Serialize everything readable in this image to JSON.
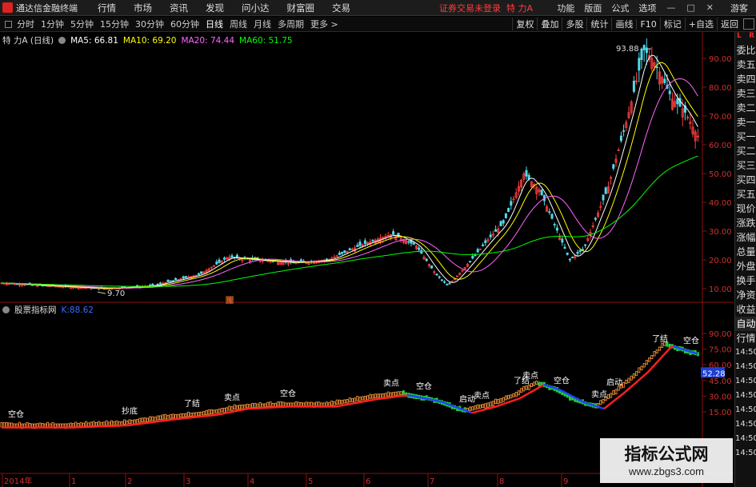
{
  "app": {
    "title": "通达信金融终端",
    "trade_status": "证券交易未登录",
    "stock_name": "特 力A",
    "guest": "游客"
  },
  "menu": [
    "行情",
    "市场",
    "资讯",
    "发现",
    "问小达",
    "财富圈",
    "交易"
  ],
  "right_menu": [
    "功能",
    "版面",
    "公式",
    "选项"
  ],
  "window_buttons": [
    "—",
    "□",
    "✕"
  ],
  "periods": [
    "分时",
    "1分钟",
    "5分钟",
    "15分钟",
    "30分钟",
    "60分钟",
    "日线",
    "周线",
    "月线",
    "多周期",
    "更多 >"
  ],
  "active_period": "日线",
  "tool_buttons": [
    "复权",
    "叠加",
    "多股",
    "统计",
    "画线",
    "F10",
    "标记",
    "+自选",
    "返回"
  ],
  "info_line": {
    "title": "特 力A (日线)",
    "ma5": "MA5: 66.81",
    "ma10": "MA10: 69.20",
    "ma20": "MA20: 74.44",
    "ma60": "MA60: 51.75",
    "colors": {
      "ma5": "#ffffff",
      "ma10": "#ffff00",
      "ma20": "#ff66ff",
      "ma60": "#00ff00"
    }
  },
  "indicator_line": {
    "title": "股票指标网",
    "value": "K:88.62"
  },
  "price_axis": [
    "90.00",
    "80.00",
    "70.00",
    "60.00",
    "50.00",
    "40.00",
    "30.00",
    "20.00",
    "10.00"
  ],
  "indicator_axis": [
    "90.00",
    "75.00",
    "60.00",
    "45.00",
    "30.00",
    "15.00"
  ],
  "current_indicator_value": "52.28",
  "time_axis": [
    "2014年",
    "1",
    "2",
    "3",
    "4",
    "5",
    "6",
    "7",
    "8",
    "9"
  ],
  "annotations": {
    "high": "93.88",
    "low": "9.70",
    "candle_flag": "库"
  },
  "signals": [
    "空仓",
    "抄底",
    "卖点",
    "了结",
    "卖点",
    "空仓",
    "卖点",
    "空仓",
    "启动",
    "卖点",
    "了结",
    "卖点",
    "空仓",
    "启动",
    "了结",
    "空仓"
  ],
  "side_tabs": [
    "委比",
    "卖五",
    "卖四",
    "卖三",
    "卖二",
    "卖一",
    "买一",
    "买二",
    "买三",
    "买四",
    "买五",
    "现价",
    "涨跌",
    "涨幅",
    "总量",
    "外盘",
    "换手",
    "净资",
    "收益",
    "自动",
    "行情",
    "14:50",
    "14:50",
    "14:50",
    "14:50",
    "14:50",
    "14:50",
    "14:50",
    "14:50"
  ],
  "side_flags": {
    "left": "L",
    "right": "R"
  },
  "watermark": {
    "title": "指标公式网",
    "url": "www.zbgs3.com"
  }
}
